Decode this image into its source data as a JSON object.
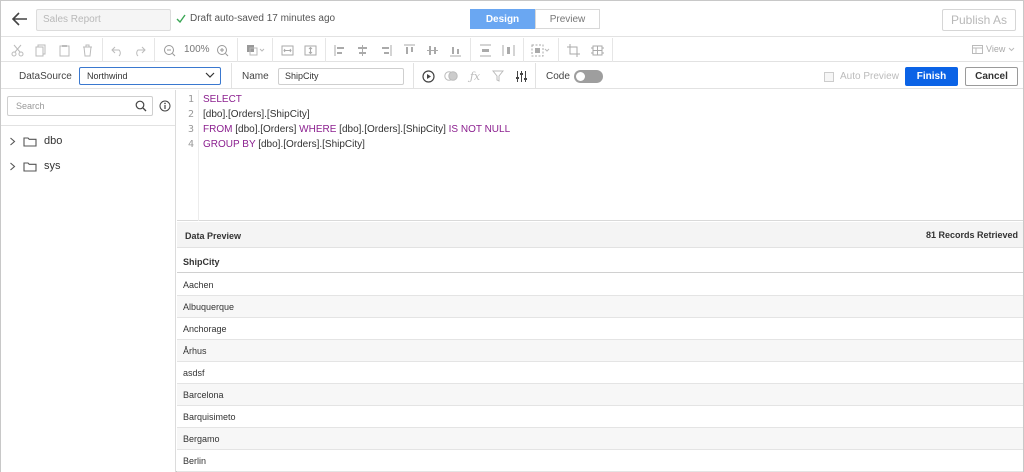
{
  "header": {
    "report_name": "Sales Report",
    "autosave_text": "Draft auto-saved 17 minutes ago",
    "design_label": "Design",
    "preview_label": "Preview",
    "publish_label": "Publish As"
  },
  "toolbar": {
    "zoom": "100%",
    "view_label": "View"
  },
  "options": {
    "datasource_label": "DataSource",
    "datasource_value": "Northwind",
    "name_label": "Name",
    "name_value": "ShipCity",
    "code_label": "Code",
    "auto_preview_label": "Auto Preview",
    "finish_label": "Finish",
    "cancel_label": "Cancel"
  },
  "sidebar": {
    "search_placeholder": "Search",
    "items": [
      {
        "label": "dbo"
      },
      {
        "label": "sys"
      }
    ]
  },
  "editor": {
    "line_numbers": [
      "1",
      "2",
      "3",
      "4"
    ],
    "line1": {
      "kw": "SELECT"
    },
    "line2": {
      "text": "[dbo].[Orders].[ShipCity]"
    },
    "line3": {
      "kw1": "FROM",
      "t1": " [dbo].[Orders] ",
      "kw2": "WHERE",
      "t2": " [dbo].[Orders].[ShipCity] ",
      "kw3": "IS NOT NULL"
    },
    "line4": {
      "kw": "GROUP BY",
      "text": " [dbo].[Orders].[ShipCity]"
    }
  },
  "preview": {
    "title": "Data Preview",
    "count": "81 Records Retrieved",
    "column": "ShipCity",
    "rows": [
      "Aachen",
      "Albuquerque",
      "Anchorage",
      "Århus",
      "asdsf",
      "Barcelona",
      "Barquisimeto",
      "Bergamo",
      "Berlin"
    ]
  },
  "colors": {
    "accent": "#0b63e6",
    "design_active": "#6aa7f2",
    "keyword": "#8b1f8f"
  }
}
